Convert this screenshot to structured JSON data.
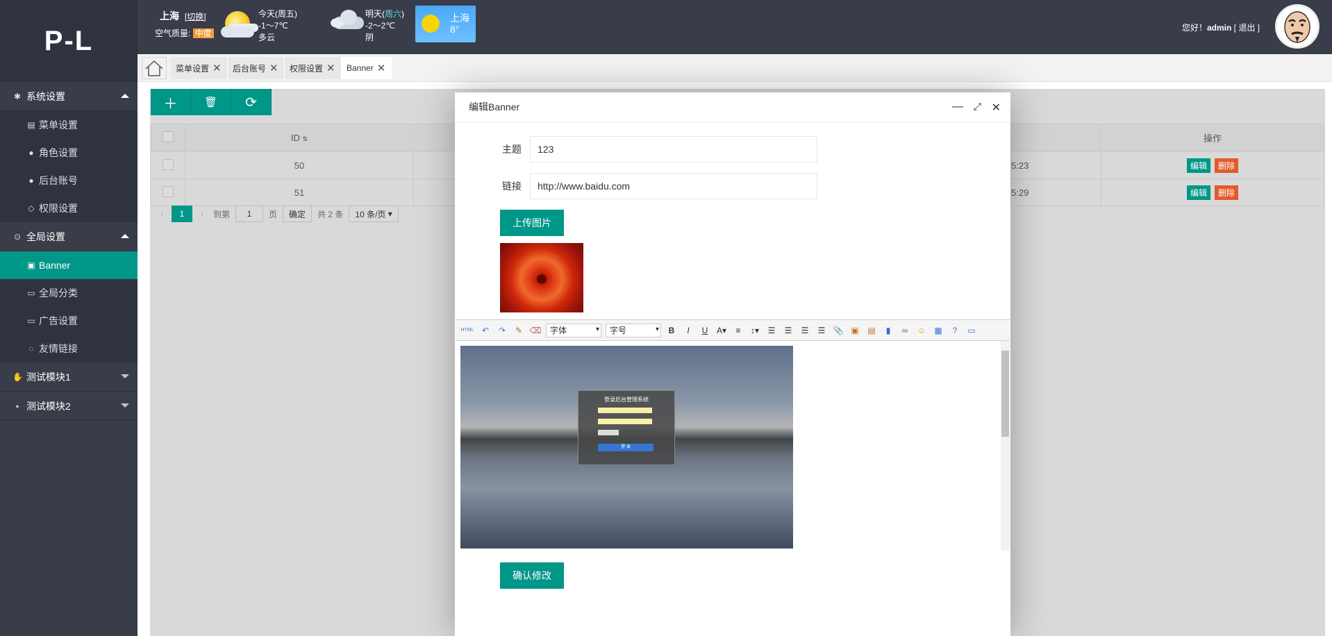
{
  "sidebar": {
    "logo": "P-L",
    "groups": [
      {
        "label": "系统设置",
        "icon": "gear-icon",
        "expanded": true,
        "items": [
          {
            "label": "菜单设置",
            "icon": "menu-icon"
          },
          {
            "label": "角色设置",
            "icon": "user-icon"
          },
          {
            "label": "后台账号",
            "icon": "users-icon"
          },
          {
            "label": "权限设置",
            "icon": "cube-icon"
          }
        ]
      },
      {
        "label": "全局设置",
        "icon": "binoculars-icon",
        "expanded": true,
        "items": [
          {
            "label": "Banner",
            "icon": "image-icon",
            "active": true
          },
          {
            "label": "全局分类",
            "icon": "tag-icon"
          },
          {
            "label": "广告设置",
            "icon": "ad-icon"
          },
          {
            "label": "友情链接",
            "icon": "link-icon"
          }
        ]
      },
      {
        "label": "测试模块1",
        "icon": "thumb-icon",
        "expanded": false
      },
      {
        "label": "测试模块2",
        "icon": "briefcase-icon",
        "expanded": false
      }
    ]
  },
  "header": {
    "city": "上海",
    "switch_label": "切换",
    "air_quality_label": "空气质量:",
    "air_quality_value": "中度",
    "today": {
      "day": "今天(周五)",
      "temp": "-1～7℃",
      "desc": "多云"
    },
    "tomorrow": {
      "day_prefix": "明天(",
      "day_weekday": "周六",
      "day_suffix": ")",
      "temp": "-2～2℃",
      "desc": "阴"
    },
    "card": {
      "city": "上海",
      "temp": "8°"
    },
    "greeting_prefix": "您好！",
    "username": "admin",
    "logout_label": "[ 退出 ]"
  },
  "tabs": [
    {
      "label": "菜单设置",
      "active": false
    },
    {
      "label": "后台账号",
      "active": false
    },
    {
      "label": "权限设置",
      "active": false
    },
    {
      "label": "Banner",
      "active": true
    }
  ],
  "table": {
    "headers": {
      "id": "ID",
      "actions": "操作"
    },
    "rows": [
      {
        "id": "50",
        "time_tail": "5:23",
        "edit": "编辑",
        "delete": "删除"
      },
      {
        "id": "51",
        "time_tail": "5:29",
        "edit": "编辑",
        "delete": "删除"
      }
    ]
  },
  "pager": {
    "current": "1",
    "goto_label": "到第",
    "goto_value": "1",
    "page_label": "页",
    "confirm": "确定",
    "total": "共 2 条",
    "per_page": "10 条/页"
  },
  "modal": {
    "title": "编辑Banner",
    "subject_label": "主题",
    "subject_value": "123",
    "link_label": "链接",
    "link_value": "http://www.baidu.com",
    "upload_label": "上传图片",
    "submit_label": "确认修改",
    "editor": {
      "font_select": "字体",
      "size_select": "字号",
      "html_label": "HTML",
      "embedded_login_title": "登录后台管理系统",
      "embedded_login_button": "登 录"
    }
  },
  "colors": {
    "primary": "#009688",
    "sidebar": "#393D49",
    "danger": "#e25a2c",
    "air_quality_badge": "#f29d38"
  }
}
